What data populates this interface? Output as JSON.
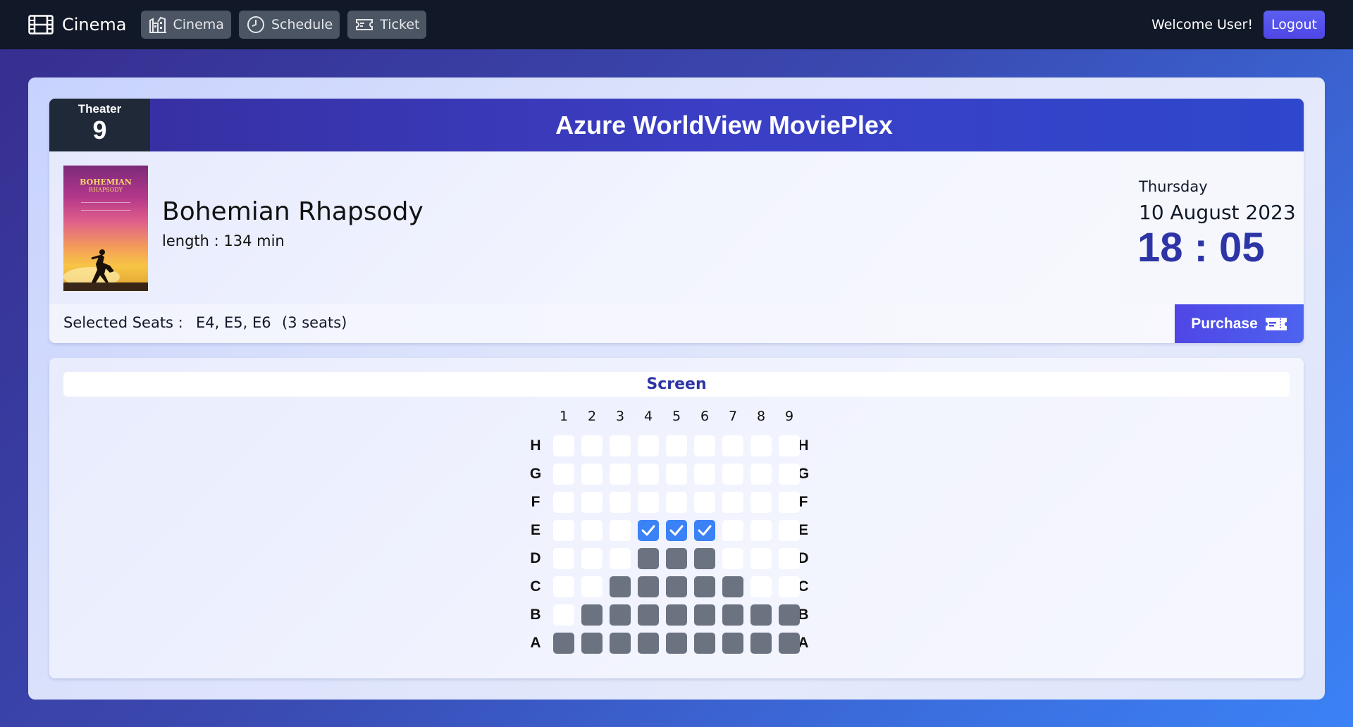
{
  "nav": {
    "brand": "Cinema",
    "links": [
      "Cinema",
      "Schedule",
      "Ticket"
    ],
    "welcome": "Welcome User!",
    "logout": "Logout"
  },
  "theater": {
    "label": "Theater",
    "number": "9",
    "cinema_name": "Azure WorldView MoviePlex"
  },
  "movie": {
    "title": "Bohemian Rhapsody",
    "length": "length : 134 min",
    "poster_title": "BOHEMIAN",
    "poster_subtitle": "RHAPSODY"
  },
  "showtime": {
    "day": "Thursday",
    "date": "10 August 2023",
    "time": "18 : 05"
  },
  "selection": {
    "label": "Selected Seats :",
    "seats": "E4, E5, E6",
    "count": "(3 seats)",
    "purchase": "Purchase"
  },
  "seating": {
    "screen_label": "Screen",
    "columns": [
      "1",
      "2",
      "3",
      "4",
      "5",
      "6",
      "7",
      "8",
      "9"
    ],
    "rows": [
      {
        "label": "H",
        "seats": [
          "available",
          "available",
          "available",
          "available",
          "available",
          "available",
          "available",
          "available",
          "available"
        ]
      },
      {
        "label": "G",
        "seats": [
          "available",
          "available",
          "available",
          "available",
          "available",
          "available",
          "available",
          "available",
          "available"
        ]
      },
      {
        "label": "F",
        "seats": [
          "available",
          "available",
          "available",
          "available",
          "available",
          "available",
          "available",
          "available",
          "available"
        ]
      },
      {
        "label": "E",
        "seats": [
          "available",
          "available",
          "available",
          "selected",
          "selected",
          "selected",
          "available",
          "available",
          "available"
        ]
      },
      {
        "label": "D",
        "seats": [
          "available",
          "available",
          "available",
          "taken",
          "taken",
          "taken",
          "available",
          "available",
          "available"
        ]
      },
      {
        "label": "C",
        "seats": [
          "available",
          "available",
          "taken",
          "taken",
          "taken",
          "taken",
          "taken",
          "available",
          "available"
        ]
      },
      {
        "label": "B",
        "seats": [
          "available",
          "taken",
          "taken",
          "taken",
          "taken",
          "taken",
          "taken",
          "taken",
          "taken"
        ]
      },
      {
        "label": "A",
        "seats": [
          "taken",
          "taken",
          "taken",
          "taken",
          "taken",
          "taken",
          "taken",
          "taken",
          "taken"
        ]
      }
    ]
  },
  "colors": {
    "available": "#ffffff",
    "taken": "#6b7280",
    "selected": "#3b82f6",
    "accent": "#2d35a6"
  }
}
